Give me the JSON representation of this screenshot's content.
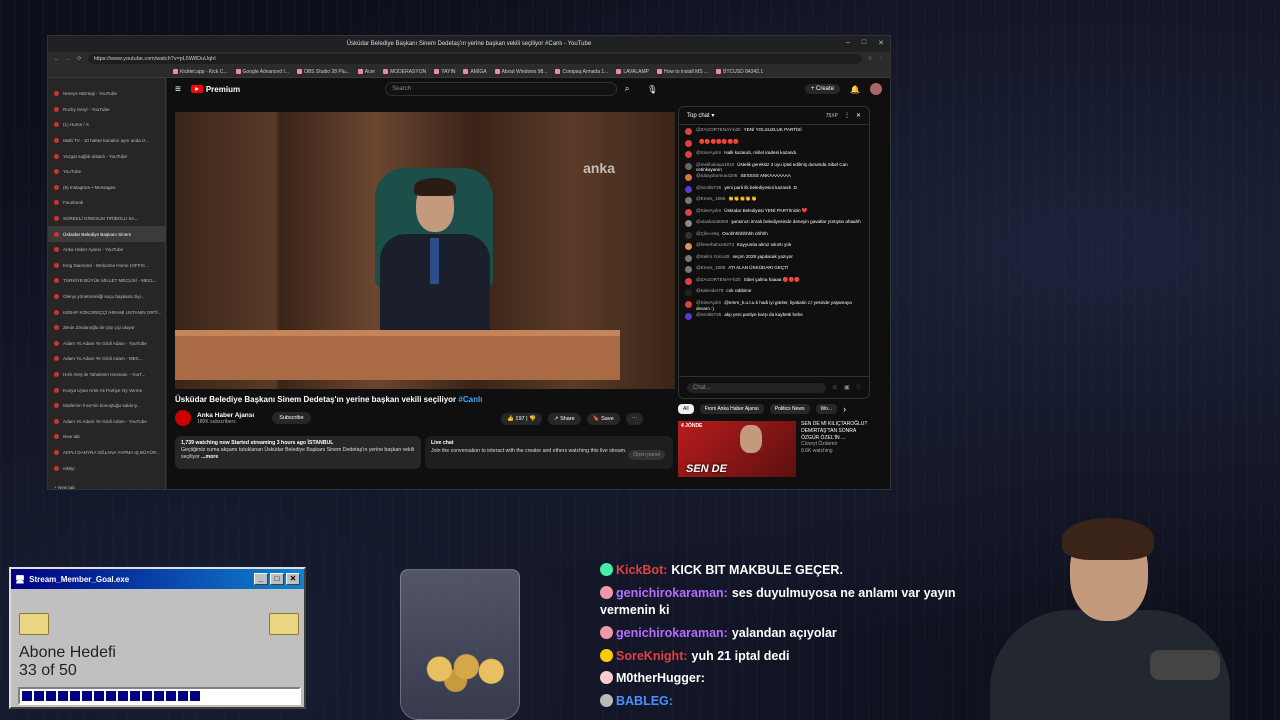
{
  "browser": {
    "title": "Üsküdar Belediye Başkanı Sinem Dedetaş'ın yerine başkan vekili seçiliyor #Canlı - YouTube",
    "url": "https://www.youtube.com/watch?v=pL5W8DuUqhI",
    "bookmarks": [
      "Kicklet.app - Kick C...",
      "Google Advanced I...",
      "OBS Studio 28 Plu...",
      "Acer",
      "MODERASYON",
      "YAYIN",
      "AMİGA",
      "About Windows 98...",
      "Compaq Armada 1...",
      "LAVALAMP",
      "How to install MS ...",
      "BTCUSD 84342.1"
    ],
    "tabs": [
      "Nereye Mizrepji - YouTube",
      "Rocky Seryl - YouTube",
      "(1) Hume / X",
      "Multi TV - 10 haber kanalını aynı anda iz...",
      "Yozgat sağlık anlatılı - YouTube",
      "YouTube",
      "(9) Instagram • Messages",
      "Facebook",
      "SÜREKLİ GİRESUN TIRİBOLU SA...",
      "Üsküdar Belediye Başkanı Sinem",
      "Anka Haber Ajansı - YouTube",
      "King Diamond - Welcome Home (OFFIC...",
      "TÜRKİYE BÜYÜK MİLLET MECLİSİ - MECL...",
      "Olenyi yönetmenliği suçu başkana ziyi...",
      "KEBAP KOKOREÇÇİ İHRAMİ USTANIN ORTİ...",
      "Zenin Zindanoğlu ile çöp çiçi oluyor",
      "Adam Yo Adam Ye Girdi Adam - YouTube",
      "Adam Yo Adam Ye Girdi Adam - MEC...",
      "Hızlı Ateş ile Tahalimin Isınması - YouT...",
      "Konya Uyan Artık Ak Partiye Oy Verme",
      "Mutlemin İnce'nin konuştuğu saldırıy...",
      "Adam Yo Adam Ye Girdi Adam - YouTube",
      "New tab",
      "AKPLİ DANYRA OĞLANA YAPMA IŞ BÜYÜR...",
      "nikityi"
    ],
    "active_tab_index": 9,
    "new_tab": "New tab"
  },
  "yt": {
    "brand": "Premium",
    "search_placeholder": "Search",
    "create_label": "Create",
    "video_title": "Üsküdar Belediye Başkanı Sinem Dedetaş'ın yerine başkan vekili seçiliyor",
    "video_tag": "#Canlı",
    "watermark": "anka",
    "channel_name": "Anka Haber Ajansı",
    "channel_subs": "180K subscribers",
    "subscribe_label": "Subscribe",
    "likes": "197",
    "share_label": "Share",
    "save_label": "Save",
    "desc_meta": "1,739 watching now  Started streaming 3 hours ago  İSTANBUL",
    "desc_text": "Geçtiğimiz cuma akşamı tutuklanan Üsküdar Belediye Başkanı Sinem Dedetaş'ın yerine başkan vekili seçiliyor",
    "desc_more": "...more",
    "live_chat_title": "Live chat",
    "live_chat_text": "Join the conversation to interact with the creator and others watching this live stream.",
    "open_panel": "Open panel"
  },
  "chat": {
    "mode": "Top chat",
    "xp": "75XP",
    "input_placeholder": "Chat...",
    "messages": [
      {
        "user": "@ZAGORTENAY-b2b",
        "text": "YENİ YOLSUZLUK PARTİSİ",
        "color": "#e04040"
      },
      {
        "user": "",
        "text": "🔴🔴🔴🔴🔴🔴🔴",
        "color": "#e04040"
      },
      {
        "user": "@SinsAydın",
        "text": "Halk kazandı, millet iradesi kazandı.",
        "color": "#e04040"
      },
      {
        "user": "@melihakaya1810",
        "text": "Üstelik gereksiz 3 oyu iptal edilmiş durumda Sibel Can cetinkayanın",
        "color": "#666"
      },
      {
        "user": "@tubaydurmus4206",
        "text": "SESSSS ANKAAAAAAA",
        "color": "#e07040"
      },
      {
        "user": "@ismik5725",
        "text": "yeni parti ilk belediyesini kazandı :D",
        "color": "#5a3ad0"
      },
      {
        "user": "@Emes_1888",
        "text": "👏👏👏👏👏",
        "color": "#777"
      },
      {
        "user": "@SinsAydın",
        "text": "Üsküdar Belediyesi YENİ PARTİmizin ❤️",
        "color": "#e04040"
      },
      {
        "user": "@ulaskara6659",
        "text": "şansınızı imralı belediyesinde deneyin gavatlar yürüyün ahaahh",
        "color": "#888"
      },
      {
        "user": "@Çiko-e5q",
        "text": "Ooohhhhhhhhh ohhhh",
        "color": "#333"
      },
      {
        "user": "@fenerbahce5273",
        "text": "Kayyumla alınız sıkıntı yok",
        "color": "#e09060"
      },
      {
        "user": "@Selim.Yolcu28",
        "text": "seçim 2028 yapılacak yazıyor",
        "color": "#777"
      },
      {
        "user": "@Emes_1888",
        "text": "ATI ALAN ÜSKÜDARI GEÇTİ",
        "color": "#777"
      },
      {
        "user": "@ZAGORTENAY-b2b",
        "text": "Sibel çalma haaaa 🔴🔴🔴",
        "color": "#e04040"
      },
      {
        "user": "@kalender78",
        "text": "cok rabbime",
        "color": "#222"
      },
      {
        "user": "@SinsAydın",
        "text": "@emre_k.u.t.u.k hadi iyi günler, liyakatin z.l yesinde yaşamaya devam :)",
        "color": "#e04040"
      },
      {
        "user": "@ismik5725",
        "text": "akp yeni partiye karşı da kaybetti hehe",
        "color": "#5a3ad0"
      }
    ]
  },
  "recos": {
    "chips": [
      "All",
      "From Anka Haber Ajansı",
      "Politics News",
      "Wo..."
    ],
    "thumb_text": "SEN DE",
    "thumb_badge": "4 JÖNDE",
    "title": "SEN DE Mİ KILIÇTAROĞLU? DEMİRTAŞ'TAN SONRA ÖZGÜR ÖZEL'İN ...",
    "channel": "Cüneyt Özdemir",
    "views": "8.6K watching"
  },
  "goal": {
    "window_title": "Stream_Member_Goal.exe",
    "label": "Abone Hedefi",
    "count_text": "33 of 50",
    "current": 33,
    "target": 50
  },
  "kick_chat": [
    {
      "name": "KickBot:",
      "text": "KICK BIT MAKBULE GEÇER.",
      "name_color": "#e04040"
    },
    {
      "name": "genichirokaraman:",
      "text": "ses duyulmuyosa ne anlamı var yayın vermenin ki",
      "name_color": "#b56cff"
    },
    {
      "name": "genichirokaraman:",
      "text": "yalandan açıyolar",
      "name_color": "#b56cff"
    },
    {
      "name": "SoreKnight:",
      "text": "yuh 21 iptal dedi",
      "name_color": "#e04040"
    },
    {
      "name": "M0therHugger:",
      "text": "",
      "name_color": "#ffffff"
    },
    {
      "name": "BABLEG:",
      "text": "",
      "name_color": "#4a90ff"
    }
  ]
}
